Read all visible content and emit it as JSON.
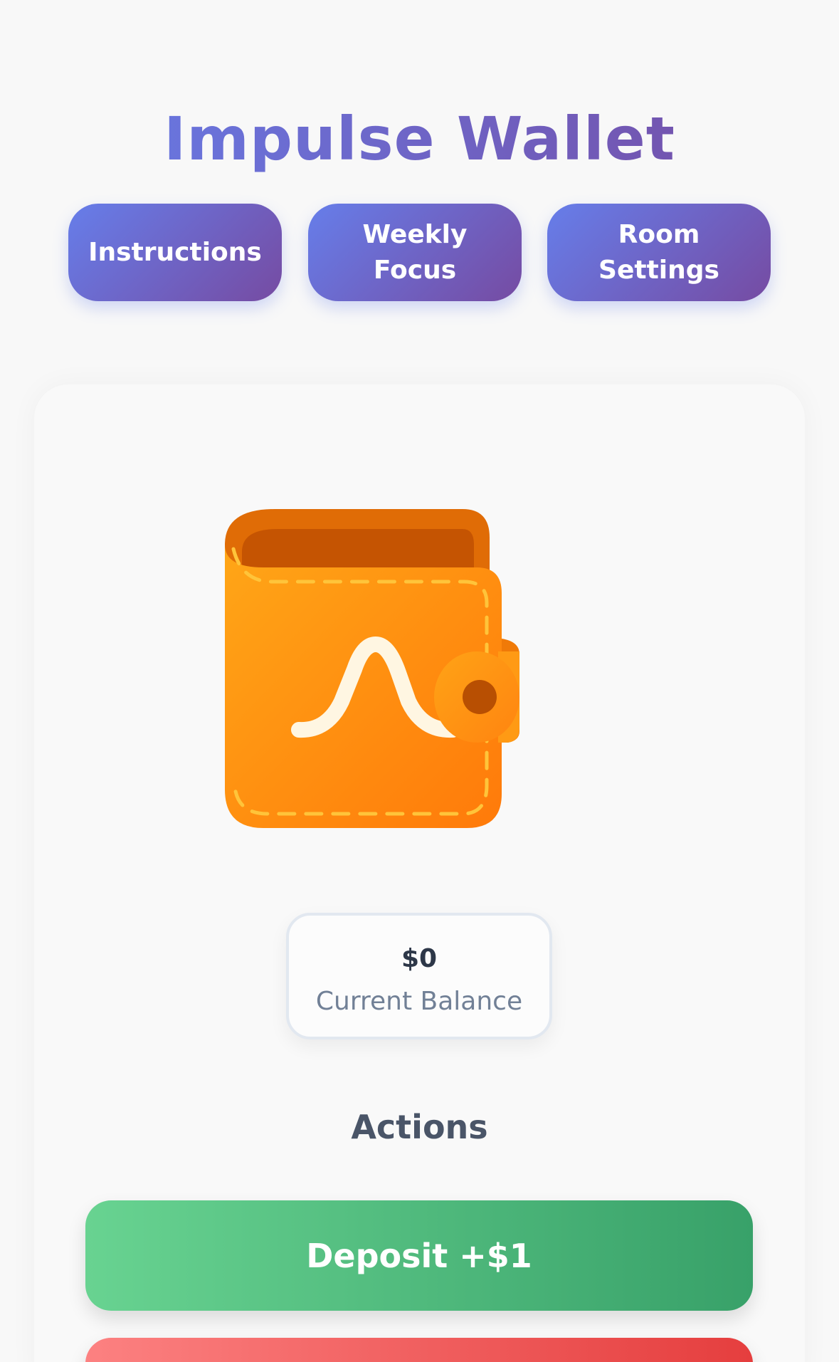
{
  "app": {
    "title": "Impulse Wallet"
  },
  "nav": {
    "instructions_label": "Instructions",
    "weekly_focus_label": "Weekly Focus",
    "room_settings_label": "Room Settings"
  },
  "balance": {
    "value": "$0",
    "label": "Current Balance"
  },
  "actions": {
    "title": "Actions",
    "deposit_label": "Deposit +$1",
    "second_label": ""
  },
  "colors": {
    "accent_start": "#667eea",
    "accent_end": "#764ba2",
    "wallet_orange": "#ff8c1a",
    "deposit_green": "#48bb78",
    "withdraw_red": "#f56565"
  },
  "icons": {
    "wallet": "wallet-icon"
  }
}
